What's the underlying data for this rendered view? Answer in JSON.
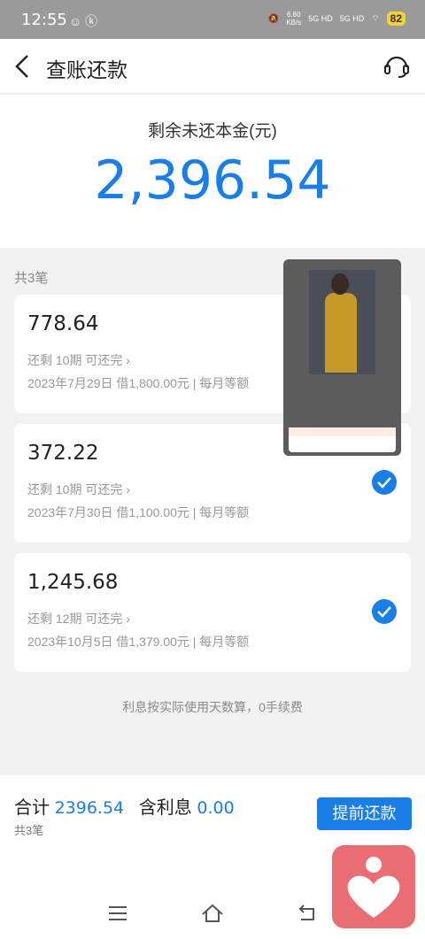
{
  "status": {
    "time": "12:55",
    "net_speed": "6.80\nKB/s",
    "sig1": "5G HD",
    "sig2": "5G HD",
    "battery": "82"
  },
  "header": {
    "title": "查账还款"
  },
  "summary": {
    "label": "剩余未还本金(元)",
    "amount": "2,396.54"
  },
  "count": "共3笔",
  "loans": [
    {
      "amount": "778.64",
      "term": "还剩 10期  可还完",
      "detail": "2023年7月29日  借1,800.00元 | 每月等额"
    },
    {
      "amount": "372.22",
      "term": "还剩 10期  可还完",
      "detail": "2023年7月30日  借1,100.00元 | 每月等额"
    },
    {
      "amount": "1,245.68",
      "term": "还剩 12期  可还完",
      "detail": "2023年10月5日  借1,379.00元 | 每月等额"
    }
  ],
  "note": "利息按实际使用天数算，0手续费",
  "bottom": {
    "total_label": "合计",
    "total_value": "2396.54",
    "interest_label": "含利息",
    "interest_value": "0.00",
    "count": "共3笔",
    "button": "提前还款"
  },
  "icons": {
    "back": "chevron-left",
    "service": "headset",
    "check": "checkmark-circle",
    "nav_menu": "menu",
    "nav_home": "home",
    "nav_back": "back"
  },
  "colors": {
    "accent": "#1a7ee8",
    "statusbar": "#9a9a9a"
  }
}
